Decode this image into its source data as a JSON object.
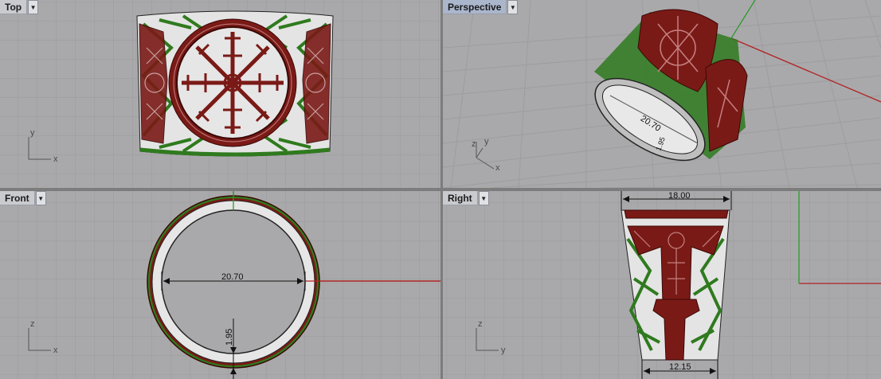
{
  "viewports": {
    "top": {
      "label": "Top",
      "menu_icon": "triangle-down-icon"
    },
    "perspective": {
      "label": "Perspective",
      "menu_icon": "triangle-down-icon"
    },
    "front": {
      "label": "Front",
      "menu_icon": "triangle-down-icon"
    },
    "right": {
      "label": "Right",
      "menu_icon": "triangle-down-icon"
    }
  },
  "axes": {
    "x": "x",
    "y": "y",
    "z": "z"
  },
  "dimensions": {
    "perspective_diameter": "20.70",
    "perspective_thickness": "1.95",
    "front_diameter": "20.70",
    "front_thickness": "1.95",
    "right_top_width": "18.00",
    "right_bottom_width": "12.15"
  },
  "colors": {
    "viewport_bg": "#a9a9ab",
    "grid": "#9c9c9e",
    "ornament_red": "#7a1a16",
    "ornament_green": "#2f7a1e",
    "metal": "#e8e8e8",
    "axis_red": "#b22222",
    "axis_green": "#2e9a2e"
  }
}
